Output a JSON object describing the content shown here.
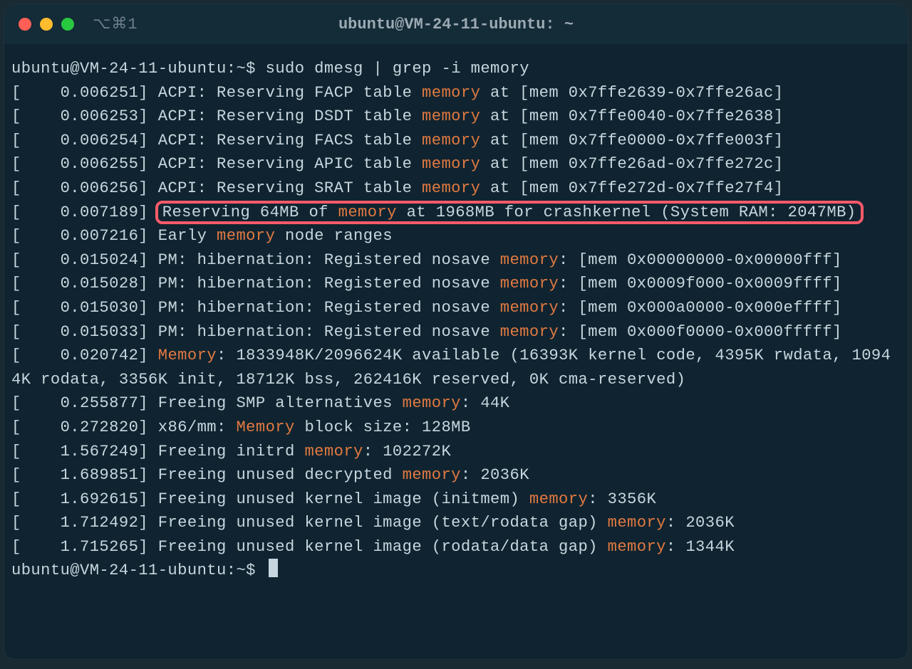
{
  "titlebar": {
    "hint": "⌥⌘1",
    "title": "ubuntu@VM-24-11-ubuntu: ~"
  },
  "prompt": {
    "userhost": "ubuntu@VM-24-11-ubuntu",
    "path": "~",
    "symbol": "$"
  },
  "command": "sudo dmesg | grep -i memory",
  "lines": [
    {
      "ts": "0.006251",
      "pre": "ACPI: Reserving FACP table ",
      "hl": "memory",
      "post": " at [mem 0x7ffe2639-0x7ffe26ac]"
    },
    {
      "ts": "0.006253",
      "pre": "ACPI: Reserving DSDT table ",
      "hl": "memory",
      "post": " at [mem 0x7ffe0040-0x7ffe2638]"
    },
    {
      "ts": "0.006254",
      "pre": "ACPI: Reserving FACS table ",
      "hl": "memory",
      "post": " at [mem 0x7ffe0000-0x7ffe003f]"
    },
    {
      "ts": "0.006255",
      "pre": "ACPI: Reserving APIC table ",
      "hl": "memory",
      "post": " at [mem 0x7ffe26ad-0x7ffe272c]"
    },
    {
      "ts": "0.006256",
      "pre": "ACPI: Reserving SRAT table ",
      "hl": "memory",
      "post": " at [mem 0x7ffe272d-0x7ffe27f4]"
    },
    {
      "ts": "0.007189",
      "boxed": true,
      "pre": "Reserving 64MB of ",
      "hl": "memory",
      "post": " at 1968MB for crashkernel (System RAM: 2047MB)"
    },
    {
      "ts": "0.007216",
      "pre": "Early ",
      "hl": "memory",
      "post": " node ranges"
    },
    {
      "ts": "0.015024",
      "pre": "PM: hibernation: Registered nosave ",
      "hl": "memory",
      "post": ": [mem 0x00000000-0x00000fff]"
    },
    {
      "ts": "0.015028",
      "pre": "PM: hibernation: Registered nosave ",
      "hl": "memory",
      "post": ": [mem 0x0009f000-0x0009ffff]"
    },
    {
      "ts": "0.015030",
      "pre": "PM: hibernation: Registered nosave ",
      "hl": "memory",
      "post": ": [mem 0x000a0000-0x000effff]"
    },
    {
      "ts": "0.015033",
      "pre": "PM: hibernation: Registered nosave ",
      "hl": "memory",
      "post": ": [mem 0x000f0000-0x000fffff]"
    },
    {
      "ts": "0.020742",
      "parts": [
        {
          "t": "",
          "h": "Memory"
        },
        {
          "t": ": 1833948K/2096624K available (16393K kernel code, 4395K rwdata, 10944K rodata, 3356K init, 18712K bss, 262416K reserved, 0K cma-reserved)"
        }
      ]
    },
    {
      "ts": "0.255877",
      "pre": "Freeing SMP alternatives ",
      "hl": "memory",
      "post": ": 44K"
    },
    {
      "ts": "0.272820",
      "pre": "x86/mm: ",
      "hl": "Memory",
      "post": " block size: 128MB"
    },
    {
      "ts": "1.567249",
      "pre": "Freeing initrd ",
      "hl": "memory",
      "post": ": 102272K"
    },
    {
      "ts": "1.689851",
      "pre": "Freeing unused decrypted ",
      "hl": "memory",
      "post": ": 2036K"
    },
    {
      "ts": "1.692615",
      "pre": "Freeing unused kernel image (initmem) ",
      "hl": "memory",
      "post": ": 3356K"
    },
    {
      "ts": "1.712492",
      "pre": "Freeing unused kernel image (text/rodata gap) ",
      "hl": "memory",
      "post": ": 2036K"
    },
    {
      "ts": "1.715265",
      "pre": "Freeing unused kernel image (rodata/data gap) ",
      "hl": "memory",
      "post": ": 1344K"
    }
  ]
}
